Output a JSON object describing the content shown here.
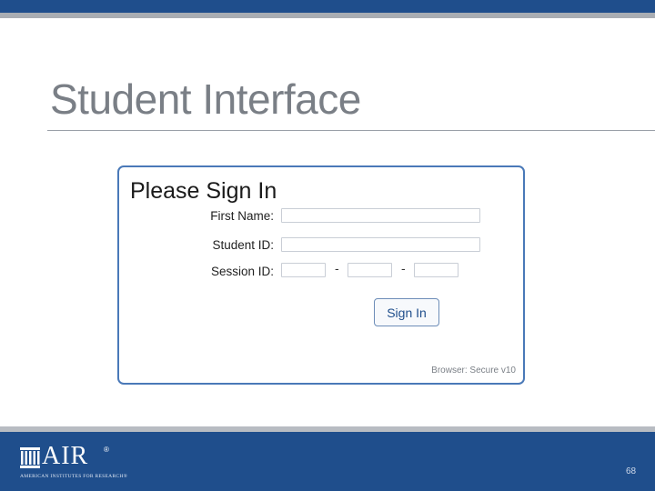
{
  "slide": {
    "title": "Student Interface",
    "page_number": "68"
  },
  "signin": {
    "heading": "Please Sign In",
    "first_name_label": "First Name:",
    "first_name_value": "",
    "student_id_label": "Student ID:",
    "student_id_value": "",
    "session_id_label": "Session ID:",
    "session_id_parts": [
      "",
      "",
      ""
    ],
    "separator": "-",
    "button_label": "Sign In",
    "browser_version": "Browser: Secure v10"
  },
  "footer": {
    "logo_text": "AIR",
    "logo_registered": "®",
    "logo_tagline": "AMERICAN INSTITUTES FOR RESEARCH®"
  },
  "colors": {
    "brand_blue": "#1f4e8c",
    "panel_border": "#4a79b8",
    "title_gray": "#7a7f86"
  }
}
